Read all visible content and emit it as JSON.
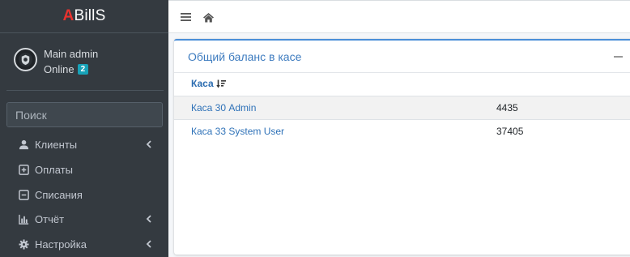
{
  "brand": {
    "accent_letter": "A",
    "rest": "BillS",
    "accent_color": "#e8322e"
  },
  "user": {
    "name": "Main admin",
    "status": "Online",
    "badge": "2",
    "avatar_icon": "admin-avatar-icon"
  },
  "search": {
    "placeholder": "Поиск",
    "icon": "search-icon"
  },
  "sidebar": {
    "items": [
      {
        "label": "Клиенты",
        "icon": "user-icon",
        "expandable": true
      },
      {
        "label": "Оплаты",
        "icon": "plus-square-icon",
        "expandable": false
      },
      {
        "label": "Списания",
        "icon": "minus-square-icon",
        "expandable": false
      },
      {
        "label": "Отчёт",
        "icon": "bar-chart-icon",
        "expandable": true
      },
      {
        "label": "Настройка",
        "icon": "gear-icon",
        "expandable": true
      }
    ]
  },
  "topbar": {
    "menu_icon": "hamburger-icon",
    "home_icon": "home-icon"
  },
  "card": {
    "title": "Общий баланс в касе",
    "column_header": "Каса",
    "sort_icon": "sort-amount-down-icon",
    "rows": [
      {
        "name": "Каса 30 Admin",
        "value": "4435"
      },
      {
        "name": "Каса 33 System User",
        "value": "37405"
      }
    ],
    "accent_color": "#4a8ed8"
  }
}
